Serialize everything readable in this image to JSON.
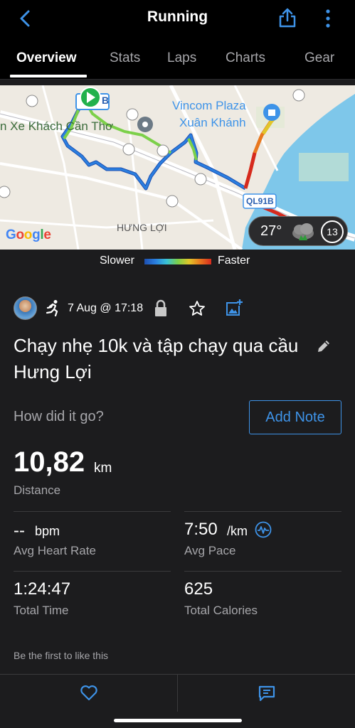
{
  "header": {
    "title": "Running",
    "back_icon": "chevron-left-icon",
    "share_icon": "share-icon",
    "more_icon": "more-vertical-icon"
  },
  "tabs": [
    {
      "label": "Overview",
      "active": true
    },
    {
      "label": "Stats",
      "active": false
    },
    {
      "label": "Laps",
      "active": false
    },
    {
      "label": "Charts",
      "active": false
    },
    {
      "label": "Gear",
      "active": false
    }
  ],
  "map": {
    "labels": {
      "station": "n Xe Khách Cần Thơ",
      "plaza_line1": "Vincom Plaza",
      "plaza_line2": "Xuân Khánh",
      "district": "HƯNG LỢI",
      "road_badge": "QL91B",
      "start_badge": "B",
      "google": "Google"
    },
    "weather": {
      "temperature": "27°",
      "wind": "13"
    }
  },
  "speed_legend": {
    "slower": "Slower",
    "faster": "Faster"
  },
  "activity": {
    "date": "7 Aug @ 17:18",
    "title": "Chạy nhẹ 10k và tập chạy qua cầu Hưng Lợi",
    "prompt": "How did it go?",
    "add_note": "Add Note"
  },
  "stats": {
    "distance": {
      "value": "10,82",
      "unit": "km",
      "label": "Distance"
    },
    "heart_rate": {
      "value": "--",
      "unit": "bpm",
      "label": "Avg Heart Rate"
    },
    "pace": {
      "value": "7:50",
      "unit": "/km",
      "label": "Avg Pace"
    },
    "time": {
      "value": "1:24:47",
      "label": "Total Time"
    },
    "calories": {
      "value": "625",
      "label": "Total Calories"
    }
  },
  "social": {
    "like_prompt": "Be the first to like this"
  },
  "colors": {
    "accent": "#3e93e8",
    "background": "#1c1c1e",
    "header": "#000000"
  }
}
